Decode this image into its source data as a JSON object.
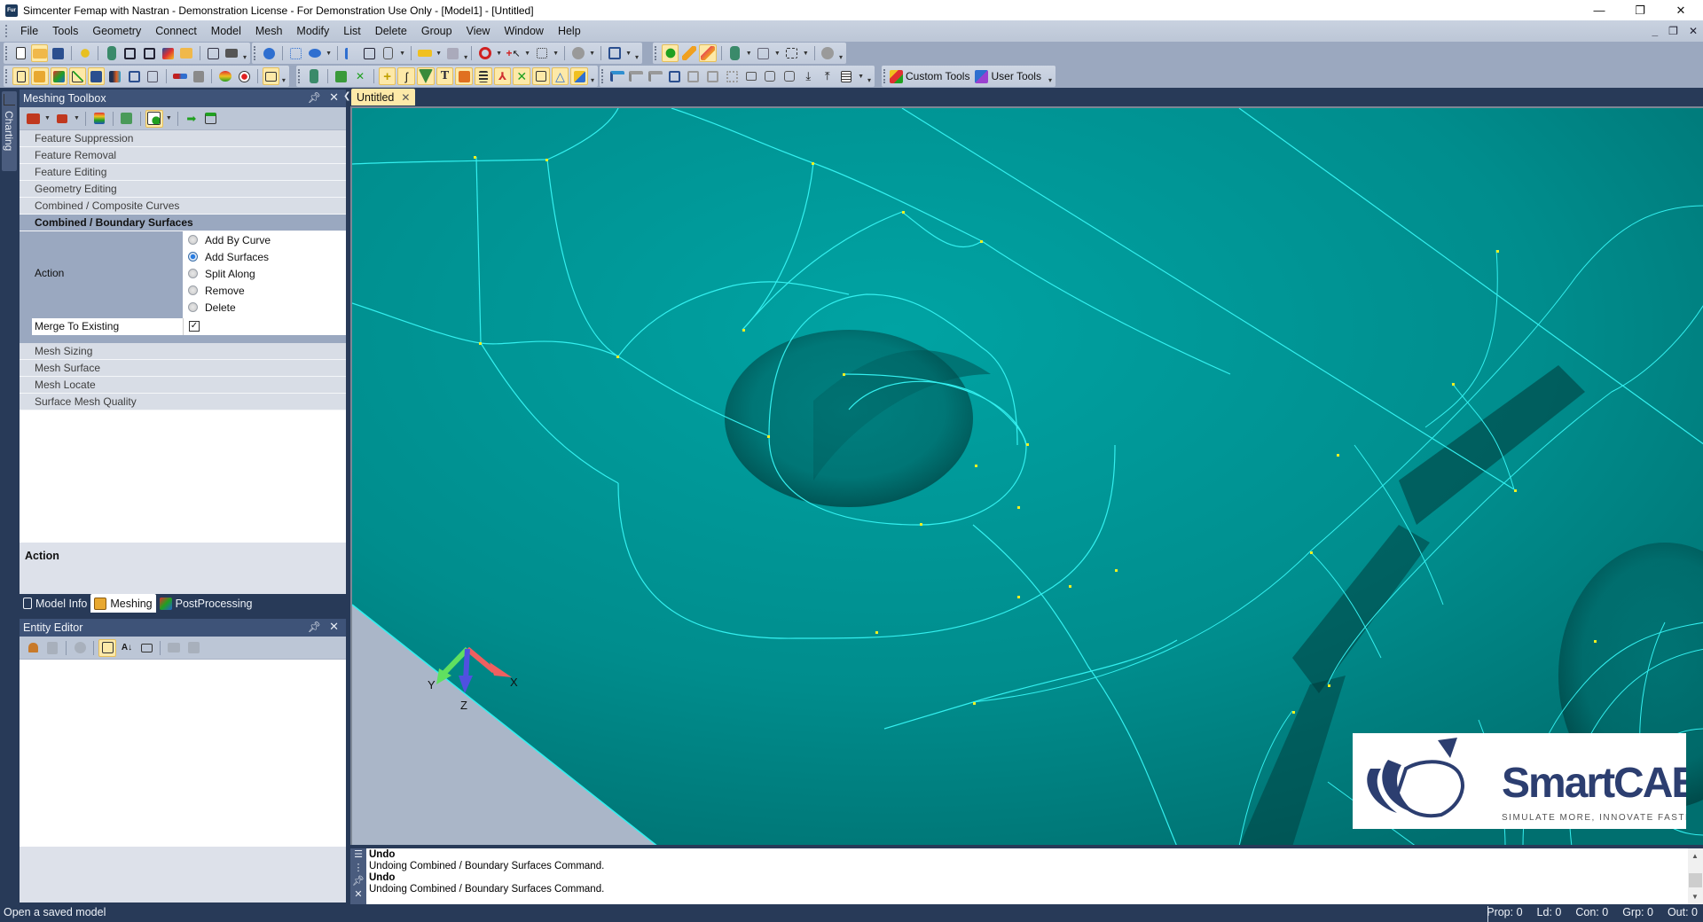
{
  "window": {
    "title": "Simcenter Femap with Nastran - Demonstration License - For Demonstration Use Only - [Model1] - [Untitled]",
    "app_icon_text": "Fur",
    "controls": {
      "minimize": "—",
      "restore": "❐",
      "close": "✕"
    },
    "mdi_controls": {
      "minimize": "_",
      "restore": "❐",
      "close": "✕"
    }
  },
  "menu": [
    "File",
    "Tools",
    "Geometry",
    "Connect",
    "Model",
    "Mesh",
    "Modify",
    "List",
    "Delete",
    "Group",
    "View",
    "Window",
    "Help"
  ],
  "toolbars": {
    "custom_tools_label": "Custom Tools",
    "user_tools_label": "User Tools",
    "row1_icons": [
      "new-file-icon",
      "open-folder-icon",
      "save-icon",
      "gears-icon",
      "import-geometry-icon",
      "import-analysis-icon",
      "export-analysis-icon",
      "export-results-icon",
      "open-results-icon",
      "copy-picture-icon",
      "print-icon",
      "rotate-view-icon",
      "view-options-icon",
      "view-style-icon",
      "entity-display-icon",
      "layers-icon",
      "model-style-icon",
      "measure-icon",
      "snap-icon",
      "pick-none-icon",
      "pick-add-icon",
      "pick-select-icon",
      "clear-icon",
      "workplane-icon",
      "select-entity-icon",
      "draw-pencil-icon",
      "erase-icon",
      "solid-color-icon",
      "grid-icon",
      "select-box-icon",
      "cancel-icon"
    ],
    "row2_icons": [
      "model-info-icon",
      "meshing-icon",
      "postprocessing-icon",
      "charting-icon",
      "entity-editor-icon",
      "data-table-icon",
      "messages-icon",
      "calculator-icon",
      "thermometer-icon",
      "trash-icon",
      "api-icon",
      "record-icon",
      "select-toolbox-icon",
      "solid-icon",
      "mesh-toolbox-icon",
      "check-icon",
      "point-icon",
      "curve-icon",
      "surface-icon",
      "text-icon",
      "volume-icon",
      "spring-icon",
      "coordsys-icon",
      "delete-x-icon",
      "panel-icon",
      "triangle-icon",
      "paint-icon",
      "align-left-icon",
      "align-mid-icon",
      "align-right-icon",
      "tile-grid-icon",
      "tile-quad-icon",
      "tile-dual-icon",
      "tile-many-icon",
      "window-cascade-icon",
      "settings-a-icon",
      "settings-b-icon",
      "download-icon",
      "upload-icon",
      "list-icon",
      "custom-tools-icon",
      "user-tools-icon"
    ]
  },
  "left_strip": {
    "charting_tab": "Charting"
  },
  "meshing_toolbox": {
    "title": "Meshing Toolbox",
    "sections_top": [
      "Feature Suppression",
      "Feature Removal",
      "Feature Editing",
      "Geometry Editing",
      "Combined / Composite Curves"
    ],
    "active_section": "Combined / Boundary Surfaces",
    "action_label": "Action",
    "action_options": [
      {
        "label": "Add By Curve",
        "checked": false
      },
      {
        "label": "Add Surfaces",
        "checked": true
      },
      {
        "label": "Split Along",
        "checked": false
      },
      {
        "label": "Remove",
        "checked": false
      },
      {
        "label": "Delete",
        "checked": false
      }
    ],
    "merge_label": "Merge To Existing",
    "merge_checked": true,
    "merge_check_glyph": "✓",
    "sections_bottom": [
      "Mesh Sizing",
      "Mesh Surface",
      "Mesh Locate",
      "Surface Mesh Quality"
    ],
    "help_title": "Action"
  },
  "bottom_tabs": [
    {
      "label": "Model Info",
      "active": false
    },
    {
      "label": "Meshing",
      "active": true
    },
    {
      "label": "PostProcessing",
      "active": false
    }
  ],
  "entity_editor": {
    "title": "Entity Editor"
  },
  "document_tab": {
    "label": "Untitled",
    "close": "✕"
  },
  "viewport": {
    "axes": {
      "x": "X",
      "y": "Y",
      "z": "Z"
    },
    "background_color": "#008b8b",
    "edge_color": "#33f0f0",
    "vertex_color": "#f0f020"
  },
  "logo": {
    "brand": "SmartCAE",
    "tagline": "SIMULATE MORE, INNOVATE FASTER"
  },
  "messages": [
    {
      "text": "Undo",
      "bold": true
    },
    {
      "text": "Undoing Combined / Boundary Surfaces Command.",
      "bold": false
    },
    {
      "text": "Undo",
      "bold": true
    },
    {
      "text": "Undoing Combined / Boundary Surfaces Command.",
      "bold": false
    }
  ],
  "status": {
    "hint": "Open a saved model",
    "counters": [
      "Prop: 0",
      "Ld: 0",
      "Con: 0",
      "Grp: 0",
      "Out: 0"
    ]
  }
}
